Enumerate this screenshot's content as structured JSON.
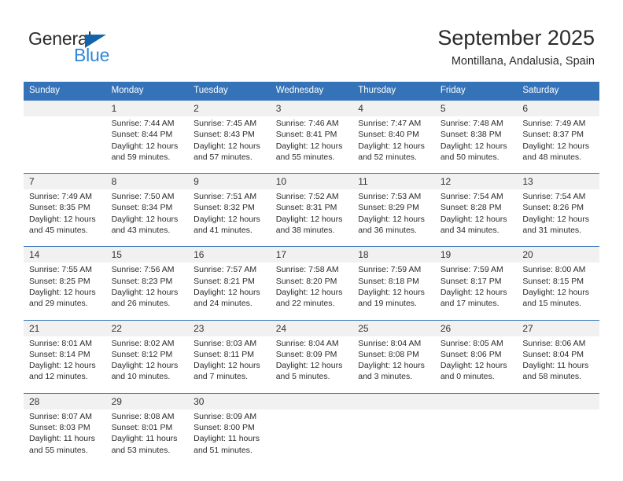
{
  "brand": {
    "name_dark": "General",
    "name_blue": "Blue",
    "triangle_color": "#1264ad",
    "blue_color": "#2f87d8"
  },
  "header": {
    "title": "September 2025",
    "subtitle": "Montillana, Andalusia, Spain"
  },
  "theme": {
    "header_blue": "#3573b9",
    "daynum_band": "#f1f1f1",
    "text": "#2b2b2b"
  },
  "calendar": {
    "weekday_headers": [
      "Sunday",
      "Monday",
      "Tuesday",
      "Wednesday",
      "Thursday",
      "Friday",
      "Saturday"
    ],
    "weeks": [
      {
        "days": [
          {
            "num": "",
            "lines": []
          },
          {
            "num": "1",
            "lines": [
              "Sunrise: 7:44 AM",
              "Sunset: 8:44 PM",
              "Daylight: 12 hours",
              "and 59 minutes."
            ]
          },
          {
            "num": "2",
            "lines": [
              "Sunrise: 7:45 AM",
              "Sunset: 8:43 PM",
              "Daylight: 12 hours",
              "and 57 minutes."
            ]
          },
          {
            "num": "3",
            "lines": [
              "Sunrise: 7:46 AM",
              "Sunset: 8:41 PM",
              "Daylight: 12 hours",
              "and 55 minutes."
            ]
          },
          {
            "num": "4",
            "lines": [
              "Sunrise: 7:47 AM",
              "Sunset: 8:40 PM",
              "Daylight: 12 hours",
              "and 52 minutes."
            ]
          },
          {
            "num": "5",
            "lines": [
              "Sunrise: 7:48 AM",
              "Sunset: 8:38 PM",
              "Daylight: 12 hours",
              "and 50 minutes."
            ]
          },
          {
            "num": "6",
            "lines": [
              "Sunrise: 7:49 AM",
              "Sunset: 8:37 PM",
              "Daylight: 12 hours",
              "and 48 minutes."
            ]
          }
        ]
      },
      {
        "days": [
          {
            "num": "7",
            "lines": [
              "Sunrise: 7:49 AM",
              "Sunset: 8:35 PM",
              "Daylight: 12 hours",
              "and 45 minutes."
            ]
          },
          {
            "num": "8",
            "lines": [
              "Sunrise: 7:50 AM",
              "Sunset: 8:34 PM",
              "Daylight: 12 hours",
              "and 43 minutes."
            ]
          },
          {
            "num": "9",
            "lines": [
              "Sunrise: 7:51 AM",
              "Sunset: 8:32 PM",
              "Daylight: 12 hours",
              "and 41 minutes."
            ]
          },
          {
            "num": "10",
            "lines": [
              "Sunrise: 7:52 AM",
              "Sunset: 8:31 PM",
              "Daylight: 12 hours",
              "and 38 minutes."
            ]
          },
          {
            "num": "11",
            "lines": [
              "Sunrise: 7:53 AM",
              "Sunset: 8:29 PM",
              "Daylight: 12 hours",
              "and 36 minutes."
            ]
          },
          {
            "num": "12",
            "lines": [
              "Sunrise: 7:54 AM",
              "Sunset: 8:28 PM",
              "Daylight: 12 hours",
              "and 34 minutes."
            ]
          },
          {
            "num": "13",
            "lines": [
              "Sunrise: 7:54 AM",
              "Sunset: 8:26 PM",
              "Daylight: 12 hours",
              "and 31 minutes."
            ]
          }
        ]
      },
      {
        "days": [
          {
            "num": "14",
            "lines": [
              "Sunrise: 7:55 AM",
              "Sunset: 8:25 PM",
              "Daylight: 12 hours",
              "and 29 minutes."
            ]
          },
          {
            "num": "15",
            "lines": [
              "Sunrise: 7:56 AM",
              "Sunset: 8:23 PM",
              "Daylight: 12 hours",
              "and 26 minutes."
            ]
          },
          {
            "num": "16",
            "lines": [
              "Sunrise: 7:57 AM",
              "Sunset: 8:21 PM",
              "Daylight: 12 hours",
              "and 24 minutes."
            ]
          },
          {
            "num": "17",
            "lines": [
              "Sunrise: 7:58 AM",
              "Sunset: 8:20 PM",
              "Daylight: 12 hours",
              "and 22 minutes."
            ]
          },
          {
            "num": "18",
            "lines": [
              "Sunrise: 7:59 AM",
              "Sunset: 8:18 PM",
              "Daylight: 12 hours",
              "and 19 minutes."
            ]
          },
          {
            "num": "19",
            "lines": [
              "Sunrise: 7:59 AM",
              "Sunset: 8:17 PM",
              "Daylight: 12 hours",
              "and 17 minutes."
            ]
          },
          {
            "num": "20",
            "lines": [
              "Sunrise: 8:00 AM",
              "Sunset: 8:15 PM",
              "Daylight: 12 hours",
              "and 15 minutes."
            ]
          }
        ]
      },
      {
        "days": [
          {
            "num": "21",
            "lines": [
              "Sunrise: 8:01 AM",
              "Sunset: 8:14 PM",
              "Daylight: 12 hours",
              "and 12 minutes."
            ]
          },
          {
            "num": "22",
            "lines": [
              "Sunrise: 8:02 AM",
              "Sunset: 8:12 PM",
              "Daylight: 12 hours",
              "and 10 minutes."
            ]
          },
          {
            "num": "23",
            "lines": [
              "Sunrise: 8:03 AM",
              "Sunset: 8:11 PM",
              "Daylight: 12 hours",
              "and 7 minutes."
            ]
          },
          {
            "num": "24",
            "lines": [
              "Sunrise: 8:04 AM",
              "Sunset: 8:09 PM",
              "Daylight: 12 hours",
              "and 5 minutes."
            ]
          },
          {
            "num": "25",
            "lines": [
              "Sunrise: 8:04 AM",
              "Sunset: 8:08 PM",
              "Daylight: 12 hours",
              "and 3 minutes."
            ]
          },
          {
            "num": "26",
            "lines": [
              "Sunrise: 8:05 AM",
              "Sunset: 8:06 PM",
              "Daylight: 12 hours",
              "and 0 minutes."
            ]
          },
          {
            "num": "27",
            "lines": [
              "Sunrise: 8:06 AM",
              "Sunset: 8:04 PM",
              "Daylight: 11 hours",
              "and 58 minutes."
            ]
          }
        ]
      },
      {
        "days": [
          {
            "num": "28",
            "lines": [
              "Sunrise: 8:07 AM",
              "Sunset: 8:03 PM",
              "Daylight: 11 hours",
              "and 55 minutes."
            ]
          },
          {
            "num": "29",
            "lines": [
              "Sunrise: 8:08 AM",
              "Sunset: 8:01 PM",
              "Daylight: 11 hours",
              "and 53 minutes."
            ]
          },
          {
            "num": "30",
            "lines": [
              "Sunrise: 8:09 AM",
              "Sunset: 8:00 PM",
              "Daylight: 11 hours",
              "and 51 minutes."
            ]
          },
          {
            "num": "",
            "lines": []
          },
          {
            "num": "",
            "lines": []
          },
          {
            "num": "",
            "lines": []
          },
          {
            "num": "",
            "lines": []
          }
        ]
      }
    ]
  }
}
